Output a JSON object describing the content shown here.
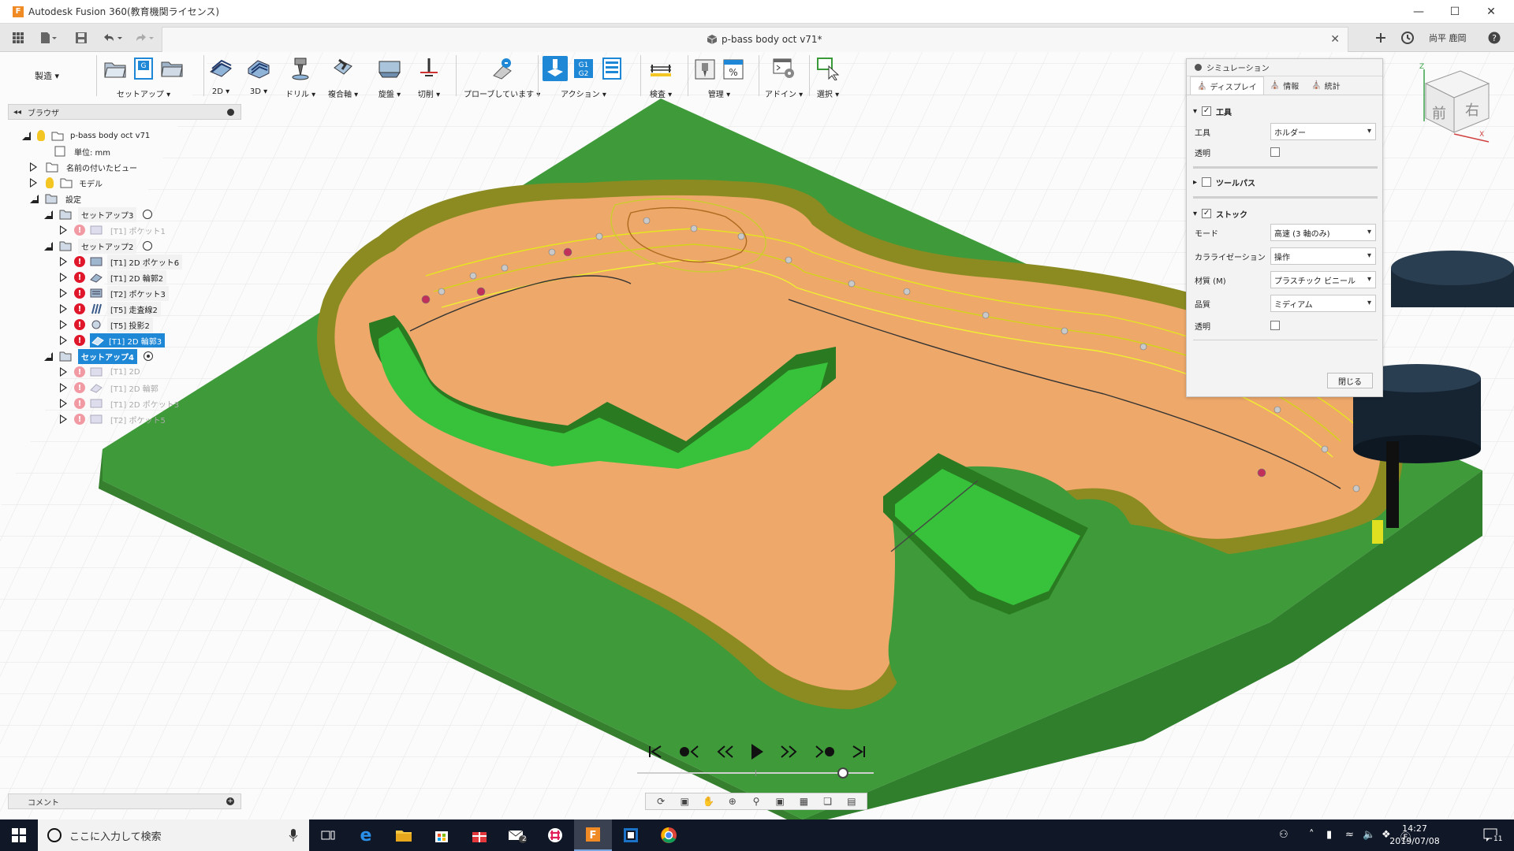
{
  "window": {
    "title": "Autodesk Fusion 360(教育機関ライセンス)",
    "app_icon_letter": "F"
  },
  "document": {
    "tab_name": "p-bass body oct v71*",
    "user_name": "尚平 鹿岡"
  },
  "toolbar": {
    "workspace": "製造",
    "groups": [
      {
        "label": "セットアップ"
      },
      {
        "label": "2D"
      },
      {
        "label": "3D"
      },
      {
        "label": "ドリル"
      },
      {
        "label": "複合軸"
      },
      {
        "label": "旋盤"
      },
      {
        "label": "切削"
      },
      {
        "label": "プローブしています"
      },
      {
        "label": "アクション"
      },
      {
        "label": "検査"
      },
      {
        "label": "管理"
      },
      {
        "label": "アドイン"
      },
      {
        "label": "選択"
      }
    ]
  },
  "browser": {
    "title": "ブラウザ",
    "root": "p-bass body oct v71",
    "units": "単位: mm",
    "named_views": "名前の付いたビュー",
    "model": "モデル",
    "settings": "設定",
    "setup3": "セットアップ3",
    "setup3_ops": [
      "[T1] ポケット1"
    ],
    "setup2": "セットアップ2",
    "setup2_ops": [
      "[T1] 2D ポケット6",
      "[T1] 2D 輪郭2",
      "[T2] ポケット3",
      "[T5] 走査線2",
      "[T5] 投影2",
      "[T1] 2D 輪郭3"
    ],
    "setup4": "セットアップ4",
    "setup4_ops": [
      "[T1] 2D",
      "[T1] 2D 輪郭",
      "[T1] 2D ポケット3",
      "[T2] ポケット5"
    ]
  },
  "comments": {
    "label": "コメント"
  },
  "simulation": {
    "title": "シミュレーション",
    "tabs": [
      "ディスプレイ",
      "情報",
      "統計"
    ],
    "tool_section": "工具",
    "tool_label": "工具",
    "tool_value": "ホルダー",
    "transparent_label": "透明",
    "toolpath_section": "ツールパス",
    "stock_section": "ストック",
    "mode_label": "モード",
    "mode_value": "高速 (3 軸のみ)",
    "colorization_label": "カラライゼーション",
    "colorization_value": "操作",
    "material_label": "材質 (M)",
    "material_value": "プラスチック ビニール",
    "quality_label": "品質",
    "quality_value": "ミディアム",
    "stock_transparent_label": "透明",
    "close_label": "閉じる"
  },
  "viewcube": {
    "front": "前",
    "right": "右",
    "axis_z": "Z",
    "axis_x": "X"
  },
  "playback": {
    "progress": 0.87
  },
  "taskbar": {
    "search_placeholder": "ここに入力して検索",
    "time": "14:27",
    "date": "2019/07/08",
    "notification_count": "11",
    "mail_badge": "2"
  },
  "colors": {
    "stock_green": "#3f9a3a",
    "body_orange": "#eda86a",
    "pocket_green": "#38c13a",
    "wall_olive": "#8a8a22",
    "accent_blue": "#1e87d6",
    "error_red": "#e0162b"
  }
}
